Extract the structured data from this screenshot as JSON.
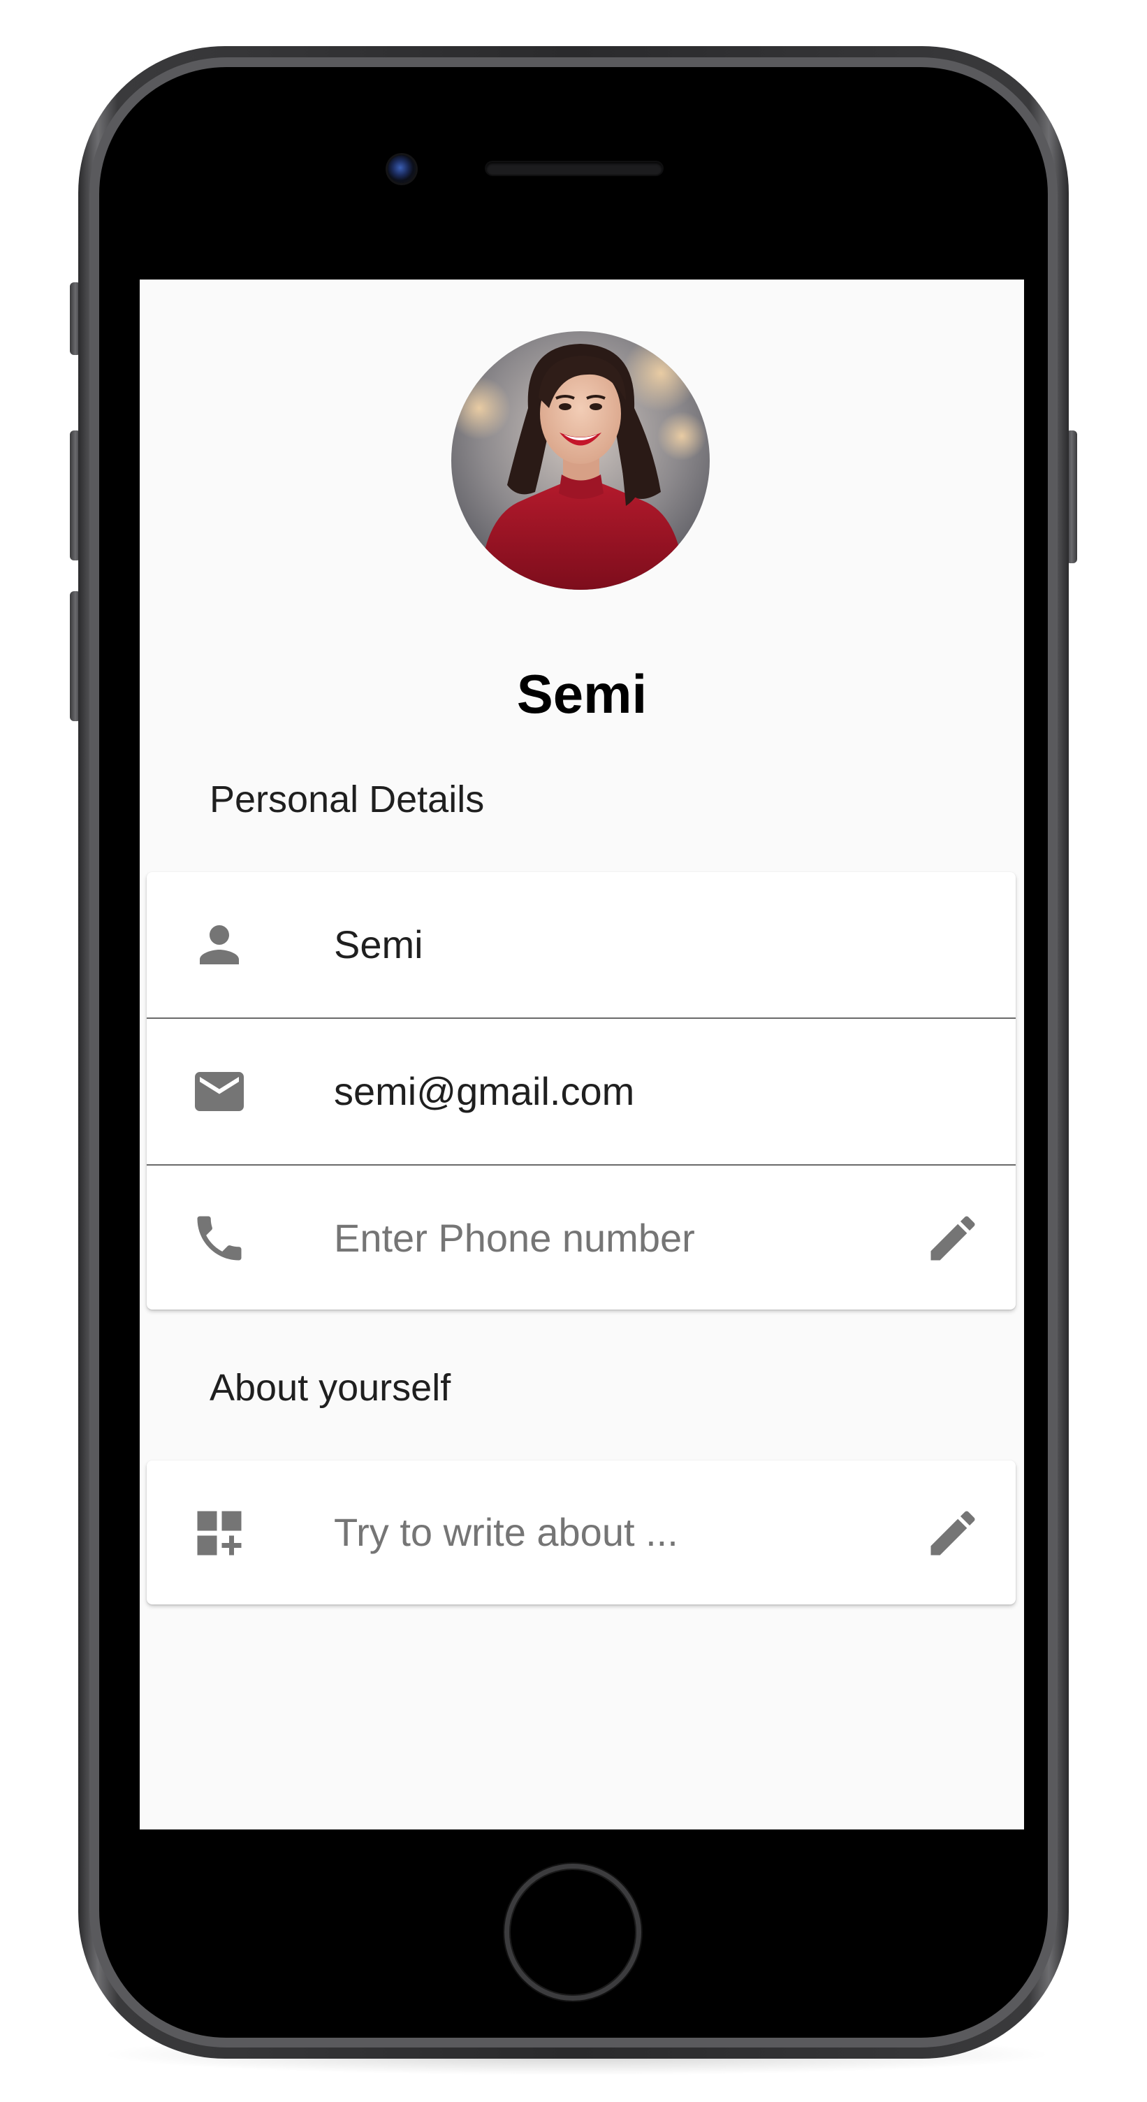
{
  "profile": {
    "name": "Semi"
  },
  "personal_details": {
    "section_title": "Personal Details",
    "name_value": "Semi",
    "email_value": "semi@gmail.com",
    "phone_placeholder": "Enter Phone number"
  },
  "about": {
    "section_title": "About yourself",
    "placeholder": "Try to write about ..."
  },
  "icons": {
    "name": "person-icon",
    "email": "mail-icon",
    "phone": "phone-icon",
    "about": "add-dashboard-icon",
    "edit": "pencil-icon"
  },
  "colors": {
    "icon_gray": "#757575",
    "background": "#fafafa",
    "card": "#ffffff",
    "divider": "#6a6a6a"
  }
}
